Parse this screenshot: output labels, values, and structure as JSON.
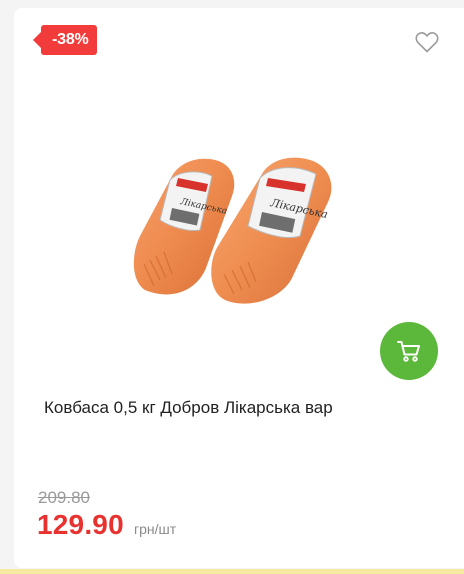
{
  "product": {
    "discount_badge": "-38%",
    "title": "Ковбаса 0,5 кг Добров Лікарська вар",
    "old_price": "209.80",
    "price": "129.90",
    "unit": "грн/шт",
    "image_alt": "Ковбаса Добров Лікарська вар",
    "label_text": "Лікарська"
  },
  "icons": {
    "favorite": "heart-icon",
    "cart": "cart-icon"
  },
  "colors": {
    "badge": "#f23b3b",
    "price": "#e8322f",
    "cart_button": "#5cb83a",
    "old_price": "#9a9a9a"
  }
}
